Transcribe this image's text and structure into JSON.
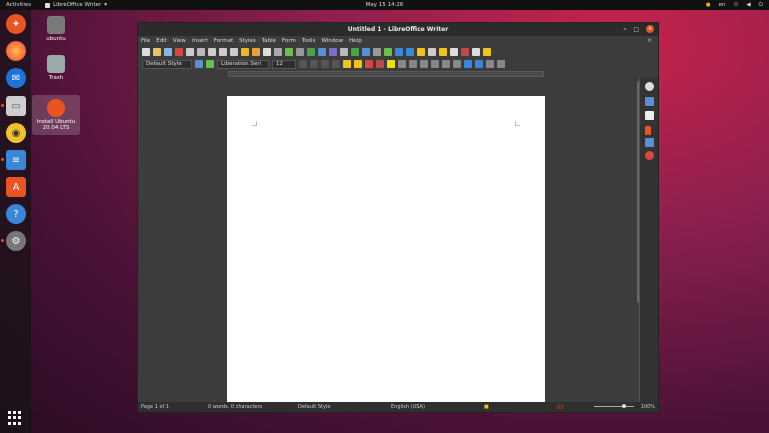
{
  "topbar": {
    "activities": "Activities",
    "app_name": "LibreOffice Writer",
    "app_menu_arrow": "▾",
    "clock": "May 15  14:26",
    "input_source": "en",
    "status_icons": [
      "network-icon",
      "volume-icon",
      "power-icon"
    ]
  },
  "dock": {
    "items": [
      {
        "name": "ubuntu-software-updater-icon",
        "color": "#e95420"
      },
      {
        "name": "firefox-icon",
        "color": "#ff7139"
      },
      {
        "name": "thunderbird-icon",
        "color": "#1c74d9"
      },
      {
        "name": "files-icon",
        "color": "#c6c6c6"
      },
      {
        "name": "rhythmbox-icon",
        "color": "#f2c12e"
      },
      {
        "name": "libreoffice-writer-icon",
        "color": "#3a86d8"
      },
      {
        "name": "ubuntu-software-icon",
        "color": "#e95420"
      },
      {
        "name": "help-icon",
        "color": "#3a86d8"
      },
      {
        "name": "settings-icon",
        "color": "#888888"
      }
    ],
    "show_apps_label": "Show Applications"
  },
  "desktop": {
    "icons": [
      {
        "label": "ubuntu"
      },
      {
        "label": "Trash"
      },
      {
        "label": "Install Ubuntu 20.04 LTS"
      }
    ]
  },
  "window": {
    "title": "Untitled 1 - LibreOffice Writer",
    "minimize": "–",
    "maximize": "□",
    "close": "×",
    "menu": [
      "File",
      "Edit",
      "View",
      "Insert",
      "Format",
      "Styles",
      "Table",
      "Form",
      "Tools",
      "Window",
      "Help"
    ],
    "doc_close": "×",
    "paragraph_style": "Default Style",
    "font_name": "Liberation Seri",
    "font_size": "12",
    "colors": {
      "accent": "#e95420",
      "window_bg": "#3c3c3c",
      "page": "#ffffff"
    }
  },
  "statusbar": {
    "page": "Page 1 of 1",
    "words": "0 words, 0 characters",
    "page_style": "Default Style",
    "language": "English (USA)",
    "zoom": "100%"
  }
}
